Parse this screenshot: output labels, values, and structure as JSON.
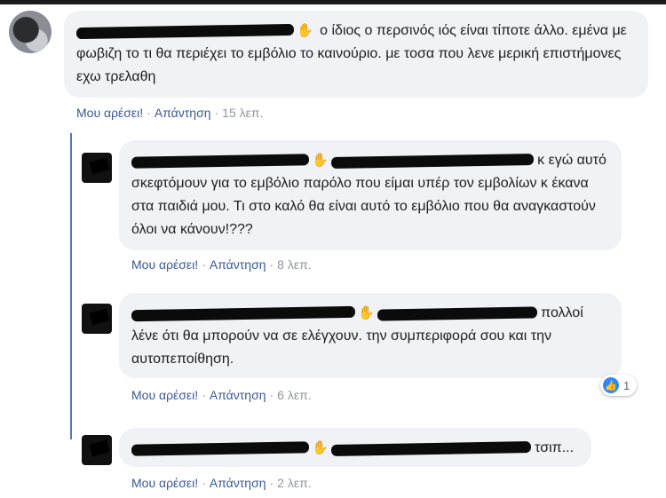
{
  "comments": [
    {
      "text": "ο ίδιος ο περσινός ιός είναι τίποτε άλλο. εμένα με φωβιζη το τι θα περιέχει το εμβόλιο το καινούριο. με τοσα που λενε μερική επιστήμονες εχω τρελαθη",
      "like_label": "Μου αρέσει!",
      "reply_label": "Απάντηση",
      "time": "15 λεπ."
    },
    {
      "text": "κ εγώ αυτό σκεφτόμουν για το εμβόλιο παρόλο που είμαι υπέρ τον εμβολίων κ έκανα στα παιδιά μου. Τι στο καλό θα είναι αυτό το εμβόλιο που θα αναγκαστούν όλοι να κάνουν!???",
      "like_label": "Μου αρέσει!",
      "reply_label": "Απάντηση",
      "time": "8 λεπ."
    },
    {
      "text": "πολλοί λένε ότι θα μπορούν να σε ελέγχουν. την συμπεριφορά σου και την αυτοπεποίθηση.",
      "like_label": "Μου αρέσει!",
      "reply_label": "Απάντηση",
      "time": "6 λεπ.",
      "reaction_count": "1"
    },
    {
      "text": "τσιπ...",
      "like_label": "Μου αρέσει!",
      "reply_label": "Απάντηση",
      "time": "2 λεπ."
    }
  ],
  "icons": {
    "like": "thumbs-up-icon",
    "mention": "hand-icon"
  },
  "colors": {
    "link": "#385898",
    "bubble": "#f0f2f5",
    "thread": "#4a78d0",
    "like": "#2d88ff"
  }
}
